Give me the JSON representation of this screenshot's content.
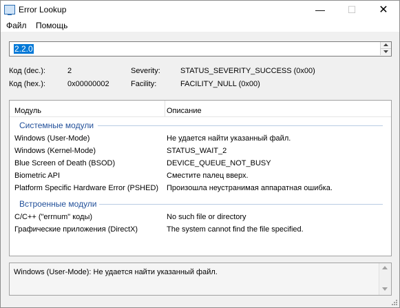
{
  "window": {
    "title": "Error Lookup",
    "minimize_glyph": "—",
    "maximize_glyph": "☐",
    "close_glyph": "✕"
  },
  "menu": [
    "Файл",
    "Помощь"
  ],
  "input": {
    "value": "2.2.0"
  },
  "info": {
    "dec_label": "Код (dec.):",
    "dec_value": "2",
    "hex_label": "Код (hex.):",
    "hex_value": "0x00000002",
    "severity_label": "Severity:",
    "severity_value": "STATUS_SEVERITY_SUCCESS (0x00)",
    "facility_label": "Facility:",
    "facility_value": "FACILITY_NULL (0x00)"
  },
  "list": {
    "col_module": "Модуль",
    "col_description": "Описание",
    "groups": [
      {
        "label": "Системные модули",
        "rows": [
          {
            "module": "Windows (User-Mode)",
            "desc": "Не удается найти указанный файл."
          },
          {
            "module": "Windows (Kernel-Mode)",
            "desc": "STATUS_WAIT_2"
          },
          {
            "module": "Blue Screen of Death (BSOD)",
            "desc": "DEVICE_QUEUE_NOT_BUSY"
          },
          {
            "module": "Biometric API",
            "desc": "Сместите палец вверх."
          },
          {
            "module": "Platform Specific Hardware Error (PSHED)",
            "desc": "Произошла неустранимая аппаратная ошибка."
          }
        ]
      },
      {
        "label": "Встроенные модули",
        "rows": [
          {
            "module": "C/C++ (\"errnum\" коды)",
            "desc": "No such file or directory"
          },
          {
            "module": "Графические приложения (DirectX)",
            "desc": "The system cannot find the file specified."
          }
        ]
      }
    ]
  },
  "detail": {
    "text": "Windows (User-Mode): Не удается найти указанный файл."
  },
  "icons": [
    "app-icon",
    "spin-up-icon",
    "spin-down-icon",
    "scroll-up-icon",
    "scroll-down-icon",
    "resize-grip-icon"
  ]
}
